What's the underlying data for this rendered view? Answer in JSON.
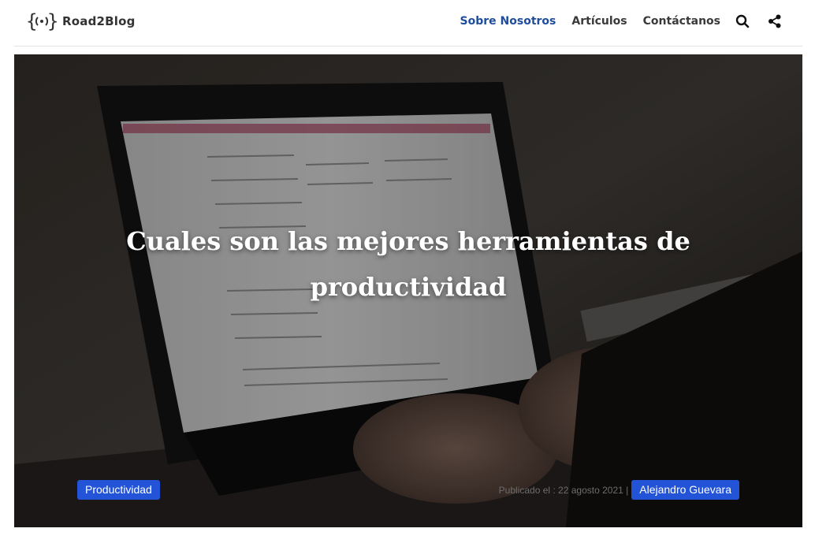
{
  "site": {
    "logo_text": "Road2Blog"
  },
  "nav": {
    "items": [
      {
        "label": "Sobre Nosotros",
        "active": true
      },
      {
        "label": "Artículos",
        "active": false
      },
      {
        "label": "Contáctanos",
        "active": false
      }
    ],
    "search_icon": "search-icon",
    "share_icon": "share-icon"
  },
  "hero": {
    "title": "Cuales son las mejores herramientas de productividad",
    "category": "Productividad",
    "published_label": "Publicado el : 22 agosto 2021 |",
    "author": "Alejandro Guevara"
  },
  "colors": {
    "accent": "#2353d6",
    "nav_active": "#1f4d9b",
    "nav_text": "#3a3a3a"
  }
}
